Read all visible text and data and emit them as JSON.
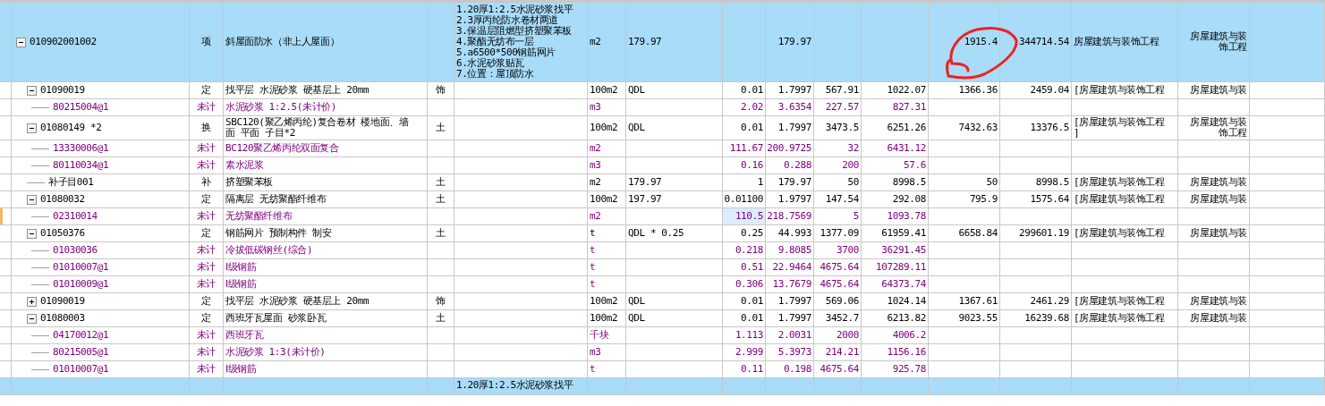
{
  "table": {
    "columns": [
      {
        "selected": false
      },
      {
        "selected": false
      },
      {
        "selected": false
      },
      {
        "selected": false
      },
      {
        "selected": false
      },
      {
        "selected": false
      },
      {
        "selected": false
      },
      {
        "selected": true
      },
      {
        "selected": false
      },
      {
        "selected": false
      },
      {
        "selected": false
      },
      {
        "selected": false
      },
      {
        "selected": false
      },
      {
        "selected": false
      },
      {
        "selected": false
      }
    ],
    "rows": [
      {
        "kind": "bill",
        "expanded": true,
        "selected": false,
        "cells": {
          "column_1": "010902001002",
          "column_2": "项",
          "column_3": "斜屋面防水（非上人屋面）",
          "column_5": "1.20厚1:2.5水泥砂浆找平\n2.3厚丙纶防水卷材两道\n3.保温层阻燃型挤塑聚苯板\n4.聚酯无纺布一层\n5.a6500*500钢筋网片\n6.水泥砂浆贴瓦\n7.位置：屋顶防水",
          "column_6": "m2",
          "column_7": "179.97",
          "column_9": "179.97",
          "column_12": "1915.4",
          "column_13": "344714.54",
          "column_14": "房屋建筑与装饰工程",
          "column_15": "房屋建筑与装饰工程"
        },
        "children": [
          {
            "kind": "quota",
            "expanded": true,
            "selected": false,
            "cells": {
              "column_1": "01090019",
              "column_2": "定",
              "column_3": "找平层 水泥砂浆 硬基层上 20mm",
              "column_4": "饰",
              "column_6": "100m2",
              "column_7": "QDL",
              "column_8": "0.01",
              "column_9": "1.7997",
              "column_10": "567.91",
              "column_11": "1022.07",
              "column_12": "1366.36",
              "column_13": "2459.04",
              "column_14": "[房屋建筑与装饰工程",
              "column_15": "房屋建筑与装"
            },
            "children": [
              {
                "kind": "material",
                "selected": false,
                "cells": {
                  "column_1": "80215004@1",
                  "column_2": "未计",
                  "column_3": "水泥砂浆 1:2.5(未计价)",
                  "column_6": "m3",
                  "column_8": "2.02",
                  "column_9": "3.6354",
                  "column_10": "227.57",
                  "column_11": "827.31"
                }
              }
            ]
          },
          {
            "kind": "quota",
            "expanded": true,
            "selected": false,
            "cells": {
              "column_1": "01080149 *2",
              "column_2": "换",
              "column_3": "SBC120(聚乙烯丙纶)复合卷材 楼地面、墙面 平面 子目*2",
              "column_4": "土",
              "column_6": "100m2",
              "column_7": "QDL",
              "column_8": "0.01",
              "column_9": "1.7997",
              "column_10": "3473.5",
              "column_11": "6251.26",
              "column_12": "7432.63",
              "column_13": "13376.5",
              "column_14": "[房屋建筑与装饰工程\n]",
              "column_15": "房屋建筑与装饰工程"
            },
            "children": [
              {
                "kind": "material",
                "selected": false,
                "cells": {
                  "column_1": "13330006@1",
                  "column_2": "未计",
                  "column_3": "BC120聚乙烯丙纶双面复合",
                  "column_6": "m2",
                  "column_8": "111.67",
                  "column_9": "200.9725",
                  "column_10": "32",
                  "column_11": "6431.12"
                }
              },
              {
                "kind": "material",
                "selected": false,
                "cells": {
                  "column_1": "80110034@1",
                  "column_2": "未计",
                  "column_3": "素水泥浆",
                  "column_6": "m3",
                  "column_8": "0.16",
                  "column_9": "0.288",
                  "column_10": "200",
                  "column_11": "57.6"
                }
              }
            ]
          },
          {
            "kind": "quota",
            "selected": false,
            "cells": {
              "column_1": "补子目001",
              "column_2": "补",
              "column_3": "挤塑聚苯板",
              "column_4": "土",
              "column_6": "m2",
              "column_7": "179.97",
              "column_8": "1",
              "column_9": "179.97",
              "column_10": "50",
              "column_11": "8998.5",
              "column_12": "50",
              "column_13": "8998.5",
              "column_14": "[房屋建筑与装饰工程",
              "column_15": "房屋建筑与装"
            }
          },
          {
            "kind": "quota",
            "expanded": true,
            "selected": false,
            "cells": {
              "column_1": "01080032",
              "column_2": "定",
              "column_3": "隔离层 无纺聚酯纤维布",
              "column_4": "土",
              "column_6": "100m2",
              "column_7": "197.97",
              "column_8": "0.01100",
              "column_9": "1.9797",
              "column_10": "147.54",
              "column_11": "292.08",
              "column_12": "795.9",
              "column_13": "1575.64",
              "column_14": "[房屋建筑与装饰工程",
              "column_15": "房屋建筑与装"
            },
            "children": [
              {
                "kind": "material",
                "selected": true,
                "cells": {
                  "column_1": "02310014",
                  "column_2": "未计",
                  "column_3": "无纺聚酯纤维布",
                  "column_6": "m2",
                  "column_8": "110.5",
                  "column_9": "218.7569",
                  "column_10": "5",
                  "column_11": "1093.78"
                }
              }
            ]
          },
          {
            "kind": "quota",
            "expanded": true,
            "selected": false,
            "cells": {
              "column_1": "01050376",
              "column_2": "定",
              "column_3": "钢筋网片 预制构件 制安",
              "column_4": "土",
              "column_6": "t",
              "column_7": "QDL * 0.25",
              "column_8": "0.25",
              "column_9": "44.993",
              "column_10": "1377.09",
              "column_11": "61959.41",
              "column_12": "6658.84",
              "column_13": "299601.19",
              "column_14": "[房屋建筑与装饰工程",
              "column_15": "房屋建筑与装"
            },
            "children": [
              {
                "kind": "material",
                "selected": false,
                "cells": {
                  "column_1": "01030036",
                  "column_2": "未计",
                  "column_3": "冷拔低碳钢丝(综合)",
                  "column_6": "t",
                  "column_8": "0.218",
                  "column_9": "9.8085",
                  "column_10": "3700",
                  "column_11": "36291.45"
                }
              },
              {
                "kind": "material",
                "selected": false,
                "cells": {
                  "column_1": "01010007@1",
                  "column_2": "未计",
                  "column_3": "Ⅰ级钢筋",
                  "column_6": "t",
                  "column_8": "0.51",
                  "column_9": "22.9464",
                  "column_10": "4675.64",
                  "column_11": "107289.11"
                }
              },
              {
                "kind": "material",
                "selected": false,
                "cells": {
                  "column_1": "01010009@1",
                  "column_2": "未计",
                  "column_3": "Ⅰ级钢筋",
                  "column_6": "t",
                  "column_8": "0.306",
                  "column_9": "13.7679",
                  "column_10": "4675.64",
                  "column_11": "64373.74"
                }
              }
            ]
          },
          {
            "kind": "quota",
            "expanded": false,
            "selected": false,
            "cells": {
              "column_1": "01090019",
              "column_2": "定",
              "column_3": "找平层 水泥砂浆 硬基层上 20mm",
              "column_4": "饰",
              "column_6": "100m2",
              "column_7": "QDL",
              "column_8": "0.01",
              "column_9": "1.7997",
              "column_10": "569.06",
              "column_11": "1024.14",
              "column_12": "1367.61",
              "column_13": "2461.29",
              "column_14": "[房屋建筑与装饰工程",
              "column_15": "房屋建筑与装"
            }
          },
          {
            "kind": "quota",
            "expanded": true,
            "selected": false,
            "cells": {
              "column_1": "01080003",
              "column_2": "定",
              "column_3": "西班牙瓦屋面 砂浆卧瓦",
              "column_4": "土",
              "column_6": "100m2",
              "column_7": "QDL",
              "column_8": "0.01",
              "column_9": "1.7997",
              "column_10": "3452.7",
              "column_11": "6213.82",
              "column_12": "9023.55",
              "column_13": "16239.68",
              "column_14": "[房屋建筑与装饰工程",
              "column_15": "房屋建筑与装"
            },
            "children": [
              {
                "kind": "material",
                "selected": false,
                "cells": {
                  "column_1": "04170012@1",
                  "column_2": "未计",
                  "column_3": "西班牙瓦",
                  "column_6": "千块",
                  "column_8": "1.113",
                  "column_9": "2.0031",
                  "column_10": "2000",
                  "column_11": "4006.2"
                }
              },
              {
                "kind": "material",
                "selected": false,
                "cells": {
                  "column_1": "80215005@1",
                  "column_2": "未计",
                  "column_3": "水泥砂浆 1:3(未计价)",
                  "column_6": "m3",
                  "column_8": "2.999",
                  "column_9": "5.3973",
                  "column_10": "214.21",
                  "column_11": "1156.16"
                }
              },
              {
                "kind": "material",
                "selected": false,
                "cells": {
                  "column_1": "01010007@1",
                  "column_2": "未计",
                  "column_3": "Ⅰ级钢筋",
                  "column_6": "t",
                  "column_8": "0.11",
                  "column_9": "0.198",
                  "column_10": "4675.64",
                  "column_11": "925.78"
                }
              }
            ]
          }
        ]
      },
      {
        "kind": "bill",
        "selected": false,
        "cells": {
          "column_5": "1.20厚1:2.5水泥砂浆找平"
        }
      }
    ]
  }
}
